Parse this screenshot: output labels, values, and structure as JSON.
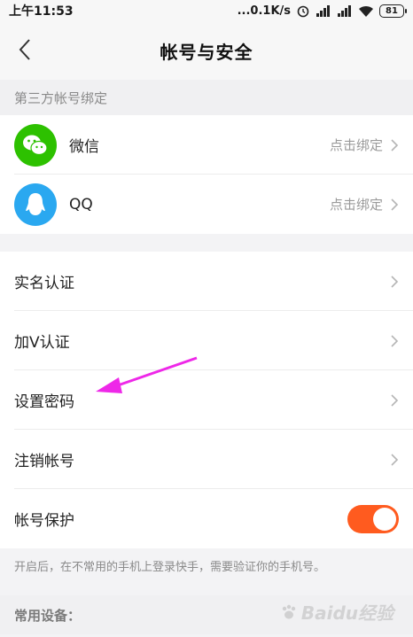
{
  "status_bar": {
    "time": "上午11:53",
    "network_speed": "...0.1K/s",
    "battery": "81"
  },
  "header": {
    "title": "帐号与安全"
  },
  "third_party": {
    "section_label": "第三方帐号绑定",
    "items": [
      {
        "label": "微信",
        "hint": "点击绑定",
        "icon": "wechat-icon"
      },
      {
        "label": "QQ",
        "hint": "点击绑定",
        "icon": "qq-icon"
      }
    ]
  },
  "settings": {
    "items": [
      {
        "label": "实名认证"
      },
      {
        "label": "加V认证"
      },
      {
        "label": "设置密码"
      },
      {
        "label": "注销帐号"
      }
    ],
    "protection": {
      "label": "帐号保护",
      "enabled": true
    }
  },
  "note": "开启后，在不常用的手机上登录快手，需要验证你的手机号。",
  "devices": {
    "section_label": "常用设备："
  },
  "watermark": "Baidu经验",
  "colors": {
    "accent": "#ff5b1f",
    "wechat": "#2dc100",
    "qq": "#2aa8f0",
    "annotation": "#ee28e8"
  }
}
